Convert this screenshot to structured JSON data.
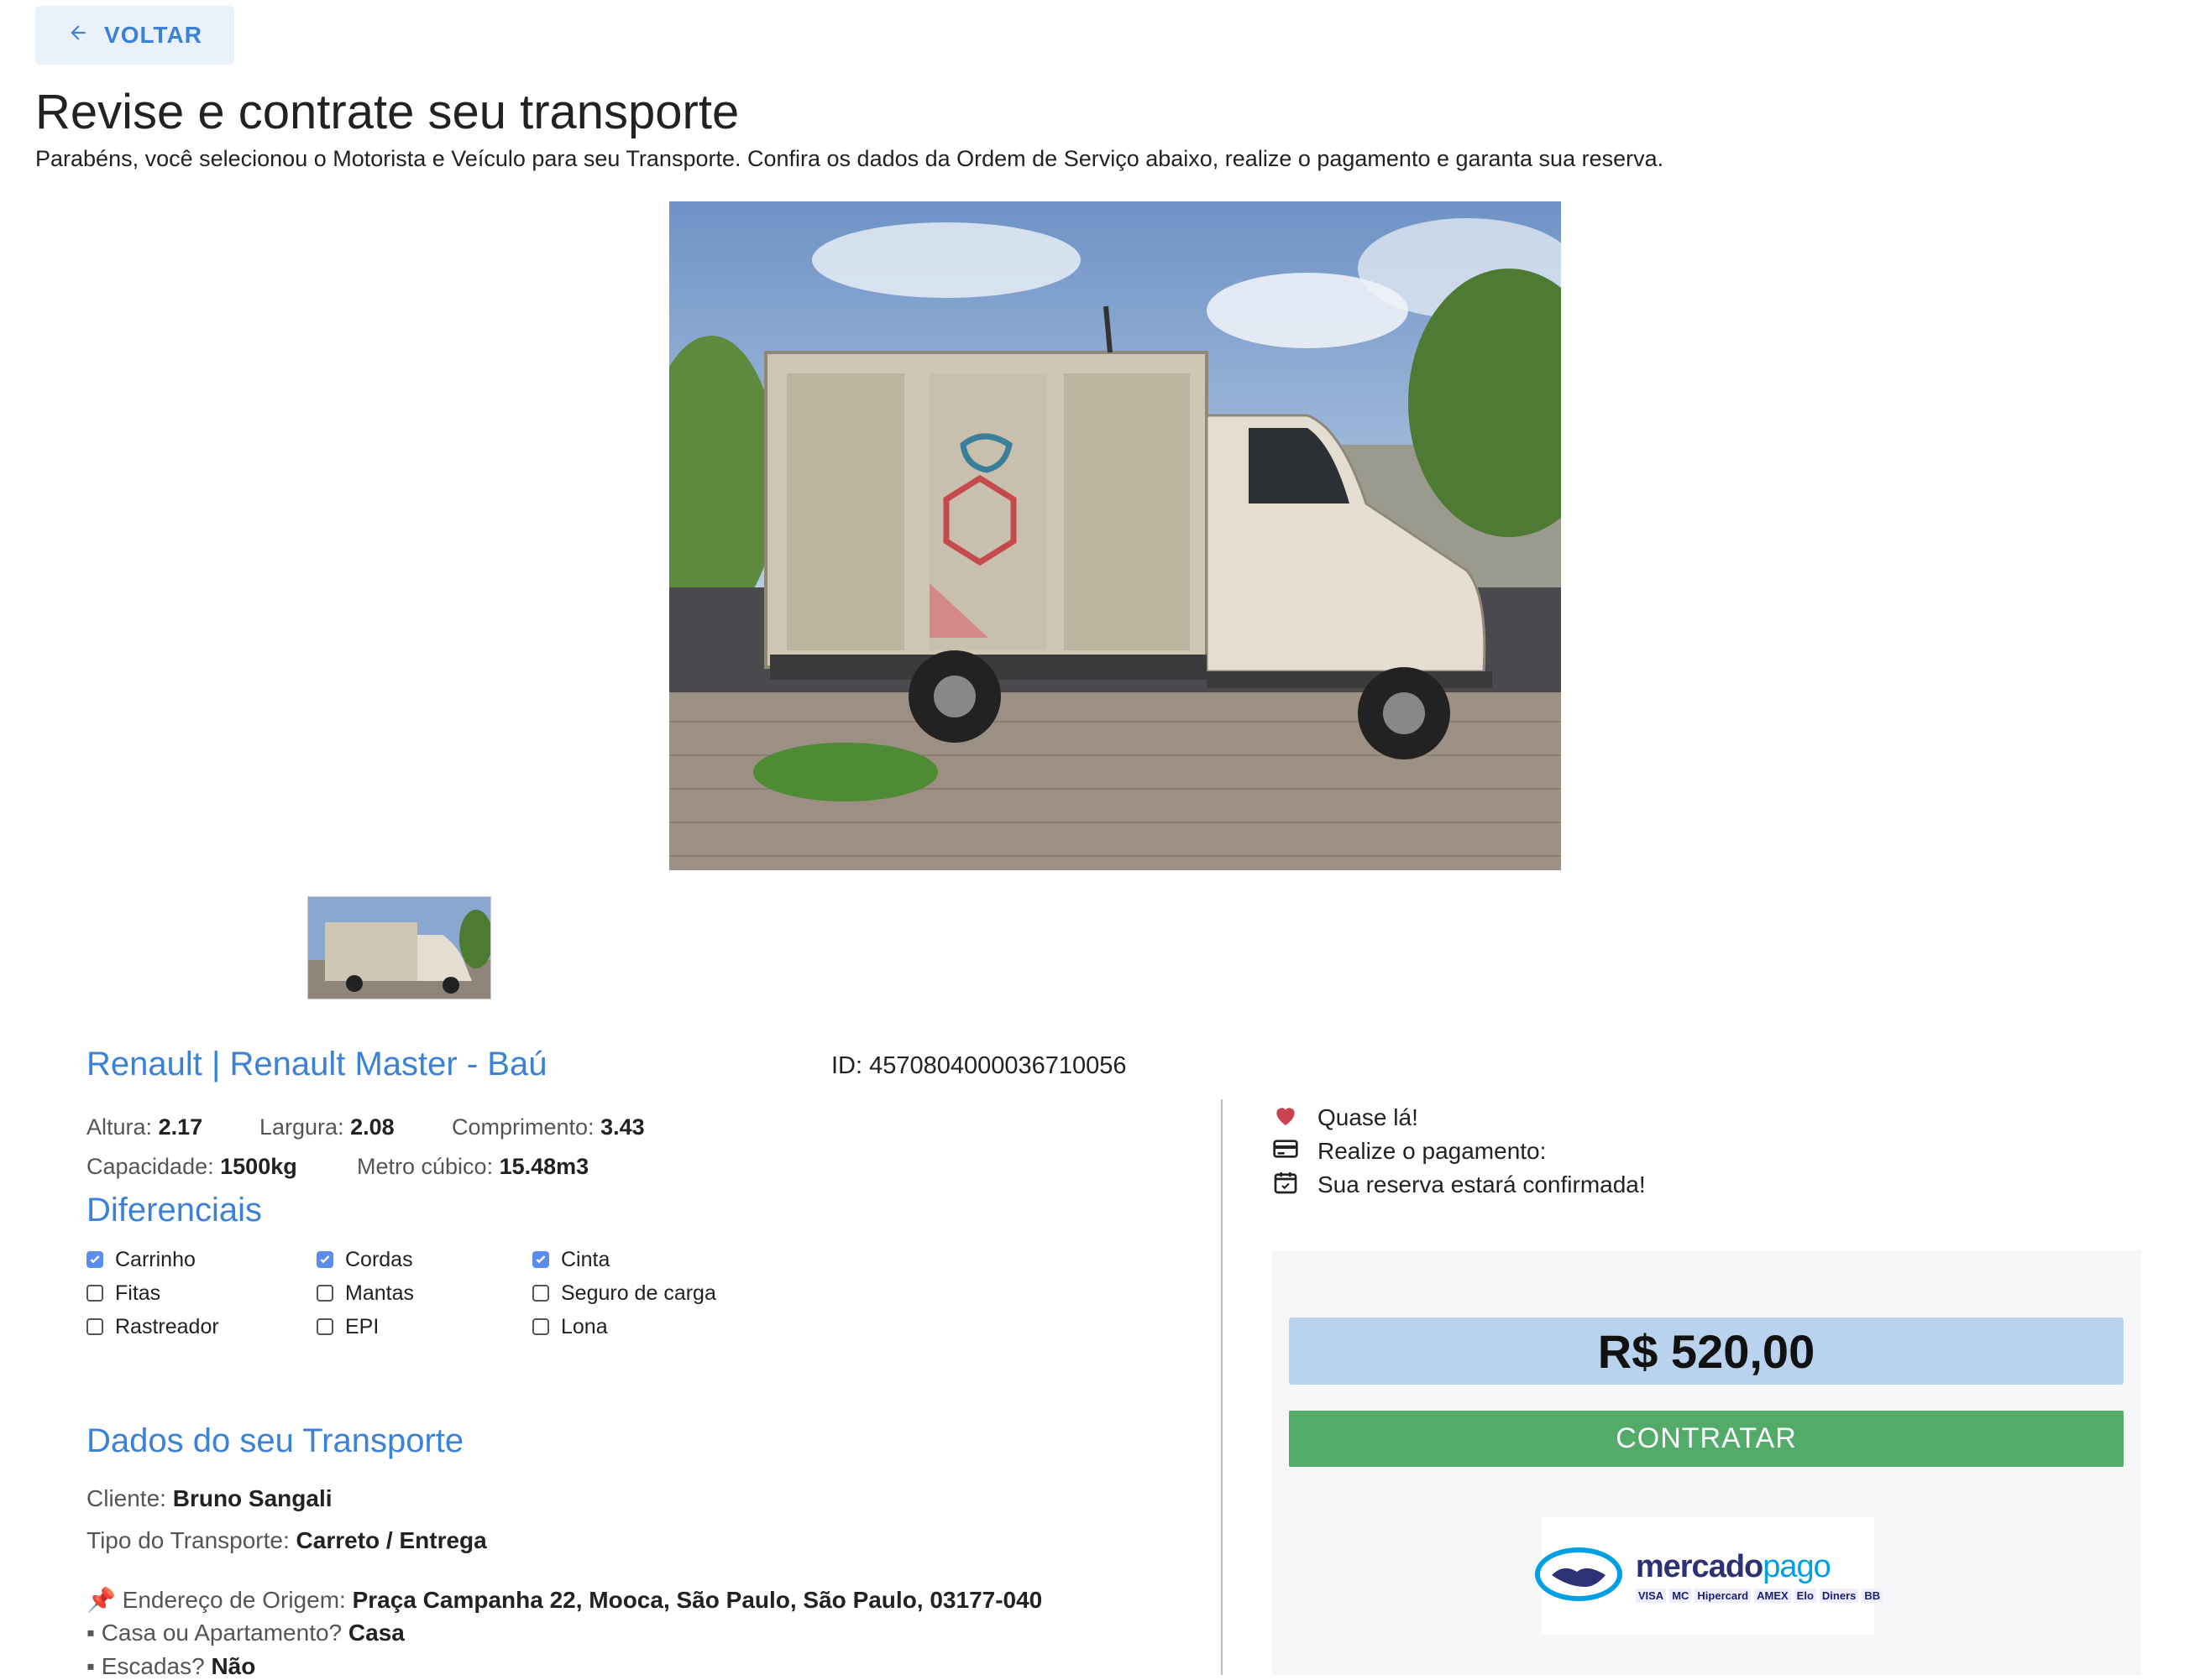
{
  "header": {
    "back_label": "VOLTAR",
    "title": "Revise e contrate seu transporte",
    "subtitle": "Parabéns, você selecionou o Motorista e Veículo para seu Transporte. Confira os dados da Ordem de Serviço abaixo, realize o pagamento e garanta sua reserva."
  },
  "vehicle": {
    "name": "Renault | Renault Master - Baú",
    "id_text": "ID: 4570804000036710056",
    "specs": {
      "altura_label": "Altura:",
      "altura": "2.17",
      "largura_label": "Largura:",
      "largura": "2.08",
      "comprimento_label": "Comprimento:",
      "comprimento": "3.43",
      "capacidade_label": "Capacidade:",
      "capacidade": "1500kg",
      "metro_label": "Metro cúbico:",
      "metro": "15.48m3"
    }
  },
  "diferenciais": {
    "title": "Diferenciais",
    "items": [
      {
        "label": "Carrinho",
        "checked": true
      },
      {
        "label": "Cordas",
        "checked": true
      },
      {
        "label": "Cinta",
        "checked": true
      },
      {
        "label": "Fitas",
        "checked": false
      },
      {
        "label": "Mantas",
        "checked": false
      },
      {
        "label": "Seguro de carga",
        "checked": false
      },
      {
        "label": "Rastreador",
        "checked": false
      },
      {
        "label": "EPI",
        "checked": false
      },
      {
        "label": "Lona",
        "checked": false
      }
    ]
  },
  "dados": {
    "title": "Dados do seu Transporte",
    "cliente_label": "Cliente:",
    "cliente": "Bruno Sangali",
    "tipo_label": "Tipo do Transporte:",
    "tipo": "Carreto / Entrega",
    "origem_icon": "📌",
    "origem_label": "Endereço de Origem:",
    "origem": "Praça Campanha 22, Mooca, São Paulo, São Paulo, 03177-040",
    "casa_label": "▪ Casa ou Apartamento?",
    "casa": "Casa",
    "escadas_label": "▪ Escadas?",
    "escadas": "Não"
  },
  "steps": {
    "items": [
      {
        "icon": "heart-icon",
        "label": "Quase lá!"
      },
      {
        "icon": "credit-card-icon",
        "label": "Realize o pagamento:"
      },
      {
        "icon": "calendar-check-icon",
        "label": "Sua reserva estará confirmada!"
      }
    ]
  },
  "payment": {
    "price": "R$ 520,00",
    "button": "CONTRATAR",
    "provider_a": "mercado",
    "provider_b": "pago",
    "cards": [
      "VISA",
      "MC",
      "Hipercard",
      "AMEX",
      "Elo",
      "Diners",
      "BB"
    ]
  },
  "colors": {
    "accent": "#3b82d6",
    "price_bg": "#b9d3ee",
    "button_bg": "#52ab69",
    "panel_bg": "#f5f6f8"
  }
}
